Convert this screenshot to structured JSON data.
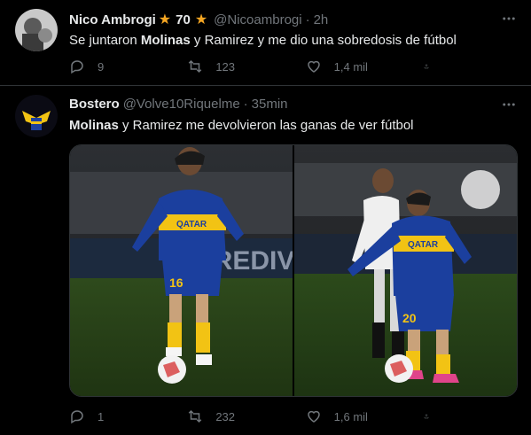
{
  "tweet1": {
    "name": "Nico Ambrogi",
    "badge_number": "70",
    "handle": "@Nicoambrogi",
    "separator": "·",
    "time": "2h",
    "text_part1": "Se juntaron ",
    "text_bold1": "Molinas",
    "text_part2": " y Ramirez y me dio una sobredosis de fútbol",
    "replies": "9",
    "retweets": "123",
    "likes": "1,4 mil"
  },
  "tweet2": {
    "name": "Bostero",
    "handle": "@Volve10Riquelme",
    "separator": "·",
    "time": "35min",
    "text_bold1": "Molinas",
    "text_part1": " y Ramirez me devolvieron las ganas de ver fútbol",
    "replies": "1",
    "retweets": "232",
    "likes": "1,6 mil",
    "photo1": {
      "number": "16",
      "sponsor": "QATAR",
      "banner": "CREDIVAL"
    },
    "photo2": {
      "number": "20",
      "sponsor": "QATAR"
    }
  },
  "colors": {
    "background": "#000000",
    "text_primary": "#e7e9ea",
    "text_secondary": "#71767b",
    "star": "#f5a623",
    "boca_blue": "#1b3f9e",
    "boca_yellow": "#f2c314"
  },
  "icons": [
    "more-icon",
    "reply-icon",
    "retweet-icon",
    "like-icon",
    "share-icon",
    "star-icon"
  ]
}
